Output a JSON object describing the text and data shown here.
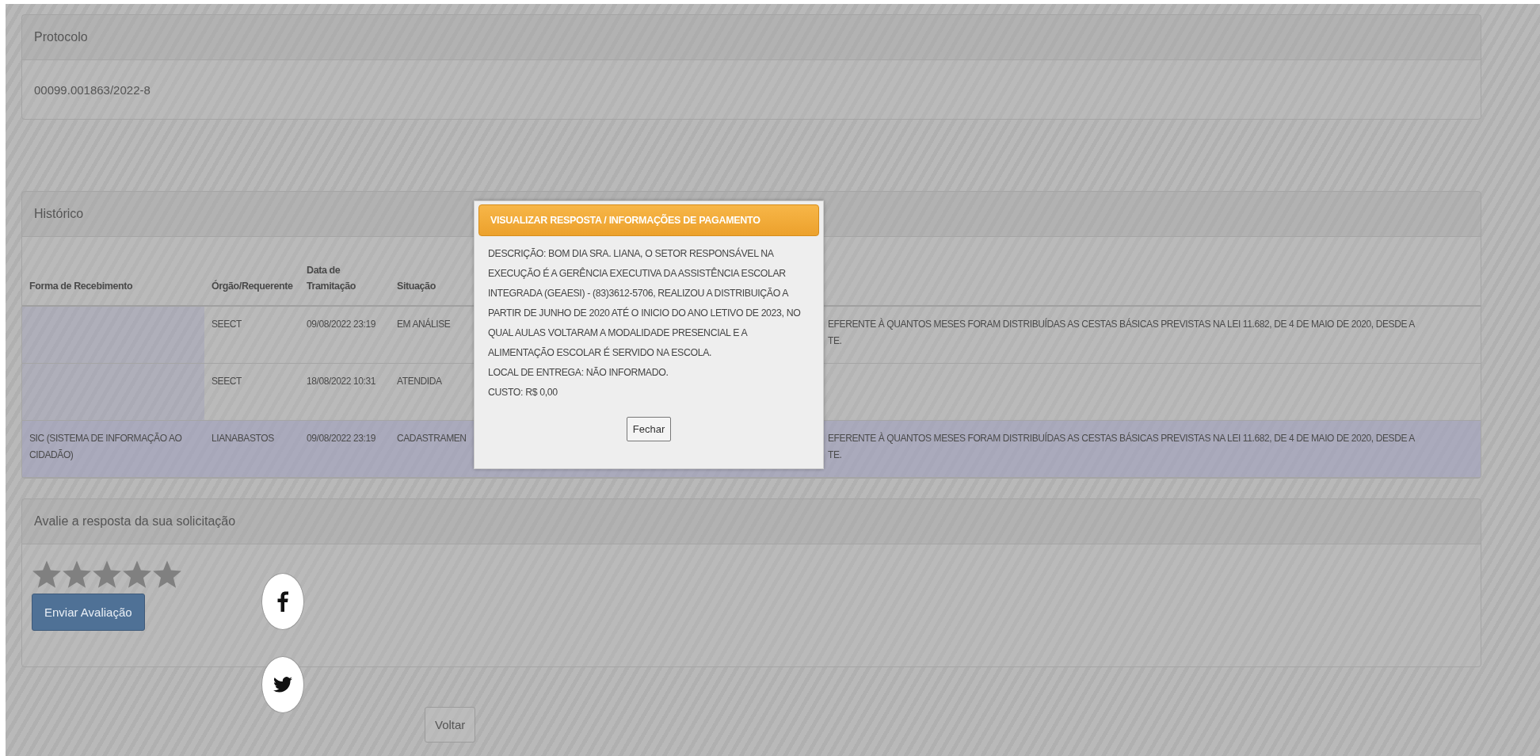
{
  "protocol": {
    "title": "Protocolo",
    "number": "00099.001863/2022-8"
  },
  "history": {
    "title": "Histórico",
    "columns": [
      "Forma de Recebimento",
      "Órgão/Requerente",
      "Data de Tramitação",
      "Situação"
    ],
    "rows": [
      {
        "selected": false,
        "form": "",
        "agency": "SEECT",
        "date": "09/08/2022 23:19",
        "status": "EM ANÁLISE",
        "description": [
          "EFERENTE À QUANTOS MESES FORAM DISTRIBUÍDAS AS CESTAS BÁSICAS PREVISTAS NA LEI 11.682, DE 4 DE MAIO DE 2020, DESDE A",
          "TE."
        ]
      },
      {
        "selected": false,
        "form": "",
        "agency": "SEECT",
        "date": "18/08/2022 10:31",
        "status": "ATENDIDA",
        "description": []
      },
      {
        "selected": true,
        "form": "SIC (SISTEMA DE INFORMAÇÃO AO CIDADÃO)",
        "agency": "LIANABASTOS",
        "date": "09/08/2022 23:19",
        "status": "CADASTRAMEN",
        "description": [
          "EFERENTE À QUANTOS MESES FORAM DISTRIBUÍDAS AS CESTAS BÁSICAS PREVISTAS NA LEI 11.682, DE 4 DE MAIO DE 2020, DESDE A",
          "TE."
        ]
      }
    ]
  },
  "rating": {
    "title": "Avalie a resposta da sua solicitação",
    "stars": 0,
    "submit": "Enviar Avaliação"
  },
  "back_button": "Voltar",
  "modal": {
    "title": "VISUALIZAR RESPOSTA / INFORMAÇÕES DE PAGAMENTO",
    "paragraphs": [
      "DESCRIÇÃO: BOM DIA SRA. LIANA, O SETOR RESPONSÁVEL NA EXECUÇÃO É A GERÊNCIA EXECUTIVA DA ASSISTÊNCIA ESCOLAR INTEGRADA (GEAESI) - (83)3612-5706, REALIZOU A DISTRIBUIÇÃO A PARTIR DE JUNHO DE 2020 ATÉ O INICIO DO ANO LETIVO DE 2023, NO QUAL AULAS VOLTARAM A MODALIDADE PRESENCIAL E A ALIMENTAÇÃO ESCOLAR É SERVIDO NA ESCOLA.",
      "LOCAL DE ENTREGA: NÃO INFORMADO.",
      "CUSTO: R$ 0,00"
    ],
    "close": "Fechar"
  }
}
